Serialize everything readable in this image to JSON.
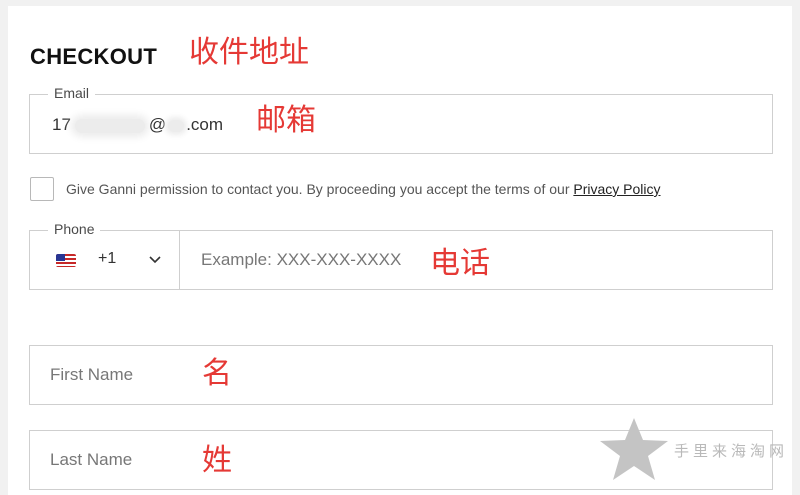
{
  "checkout": {
    "title": "CHECKOUT",
    "annotation": "收件地址"
  },
  "email": {
    "label": "Email",
    "value_prefix": "17",
    "value_at": "@",
    "value_suffix": ".com",
    "annotation": "邮箱"
  },
  "consent": {
    "text": "Give Ganni permission to contact you. By proceeding you accept the terms of our ",
    "link": "Privacy Policy",
    "checked": false
  },
  "phone": {
    "label": "Phone",
    "country_code": "+1",
    "flag_icon": "us-flag-icon",
    "placeholder": "Example: XXX-XXX-XXXX",
    "annotation": "电话"
  },
  "first_name": {
    "placeholder": "First Name",
    "annotation": "名"
  },
  "last_name": {
    "placeholder": "Last Name",
    "annotation": "姓"
  },
  "watermark": {
    "text": "手里来海淘网",
    "icon": "star-icon"
  },
  "colors": {
    "annotation": "#e53935",
    "border": "#cfcfcf",
    "background": "#f1f1f1"
  }
}
